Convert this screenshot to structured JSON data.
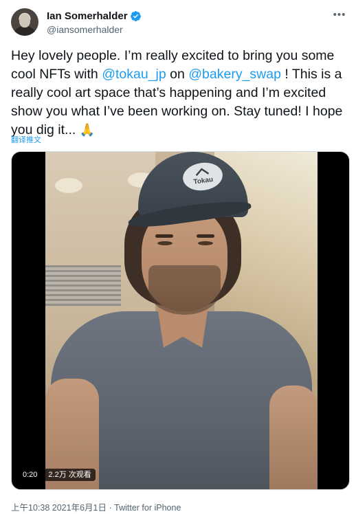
{
  "author": {
    "display_name": "Ian Somerhalder",
    "handle": "@iansomerhalder",
    "verified": true
  },
  "tweet": {
    "text_segments": [
      {
        "type": "text",
        "value": "Hey lovely people. I’m really excited to bring you some cool NFTs with "
      },
      {
        "type": "mention",
        "value": "@tokau_jp"
      },
      {
        "type": "text",
        "value": " on "
      },
      {
        "type": "mention",
        "value": "@bakery_swap"
      },
      {
        "type": "text",
        "value": " ! This is a really cool art space that’s happening and I’m excited show you what I’ve been working on. Stay tuned! I hope you dig it... "
      },
      {
        "type": "emoji",
        "value": "🙏"
      }
    ],
    "translate_label": "翻译推文"
  },
  "media": {
    "type": "video",
    "duration": "0:20",
    "views": "2.2万 次观看",
    "cap_logo_text": "Tokau"
  },
  "meta": {
    "time": "上午10:38",
    "date": "2021年6月1日",
    "separator": "·",
    "source": "Twitter for iPhone"
  },
  "icons": {
    "more": "more-dots-icon",
    "verified": "verified-badge-icon"
  },
  "colors": {
    "link": "#1d9bf0",
    "secondary_text": "#536471",
    "primary_text": "#0f1419",
    "verified": "#1d9bf0"
  }
}
